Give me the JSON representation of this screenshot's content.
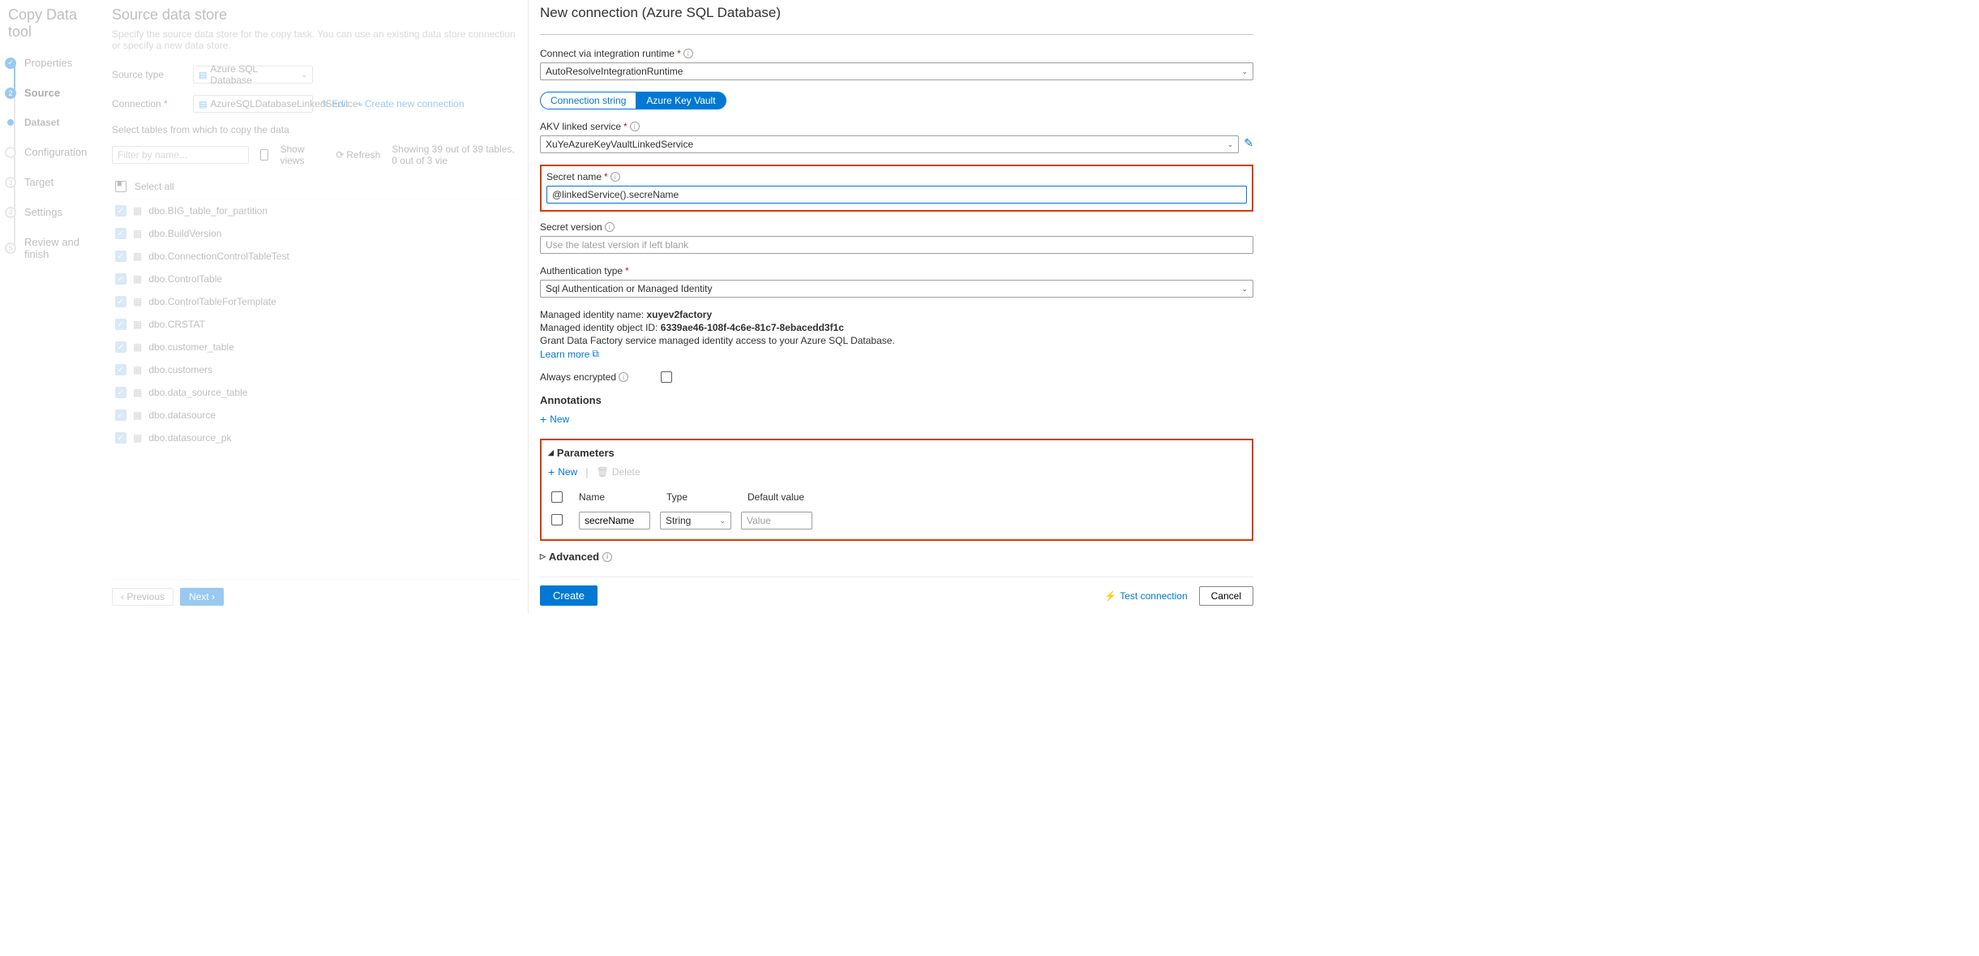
{
  "tool_title": "Copy Data tool",
  "steps": {
    "properties": "Properties",
    "source": "Source",
    "dataset": "Dataset",
    "configuration": "Configuration",
    "target": "Target",
    "settings": "Settings",
    "review": "Review and finish"
  },
  "main": {
    "title": "Source data store",
    "desc": "Specify the source data store for the copy task. You can use an existing data store connection or specify a new data store.",
    "source_type_label": "Source type",
    "source_type_value": "Azure SQL Database",
    "connection_label": "Connection",
    "connection_value": "AzureSQLDatabaseLinkedService",
    "edit_label": "Edit",
    "new_conn_label": "Create new connection",
    "select_tables_label": "Select tables from which to copy the data",
    "filter_placeholder": "Filter by name...",
    "show_views": "Show views",
    "refresh": "Refresh",
    "status": "Showing 39 out of 39 tables, 0 out of 3 vie",
    "select_all": "Select all",
    "tables": [
      "dbo.BIG_table_for_partition",
      "dbo.BuildVersion",
      "dbo.ConnectionControlTableTest",
      "dbo.ControlTable",
      "dbo.ControlTableForTemplate",
      "dbo.CRSTAT",
      "dbo.customer_table",
      "dbo.customers",
      "dbo.data_source_table",
      "dbo.datasource",
      "dbo.datasource_pk"
    ],
    "previous": "Previous",
    "next": "Next"
  },
  "panel": {
    "title": "New connection (Azure SQL Database)",
    "connect_via_label": "Connect via integration runtime",
    "connect_via_value": "AutoResolveIntegrationRuntime",
    "tab_conn_string": "Connection string",
    "tab_akv": "Azure Key Vault",
    "akv_linked_label": "AKV linked service",
    "akv_linked_value": "XuYeAzureKeyVaultLinkedService",
    "secret_name_label": "Secret name",
    "secret_name_value": "@linkedService().secreName",
    "secret_version_label": "Secret version",
    "secret_version_placeholder": "Use the latest version if left blank",
    "auth_type_label": "Authentication type",
    "auth_type_value": "Sql Authentication or Managed Identity",
    "mi_name_label": "Managed identity name:",
    "mi_name_value": "xuyev2factory",
    "mi_id_label": "Managed identity object ID:",
    "mi_id_value": "6339ae46-108f-4c6e-81c7-8ebacedd3f1c",
    "grant_text": "Grant Data Factory service managed identity access to your Azure SQL Database.",
    "learn_more": "Learn more",
    "always_encrypted": "Always encrypted",
    "annotations": "Annotations",
    "annotations_new": "New",
    "parameters": "Parameters",
    "param_new": "New",
    "param_delete": "Delete",
    "param_header_name": "Name",
    "param_header_type": "Type",
    "param_header_default": "Default value",
    "param_name_value": "secreName",
    "param_type_value": "String",
    "param_default_placeholder": "Value",
    "advanced": "Advanced",
    "create": "Create",
    "test_connection": "Test connection",
    "cancel": "Cancel"
  }
}
